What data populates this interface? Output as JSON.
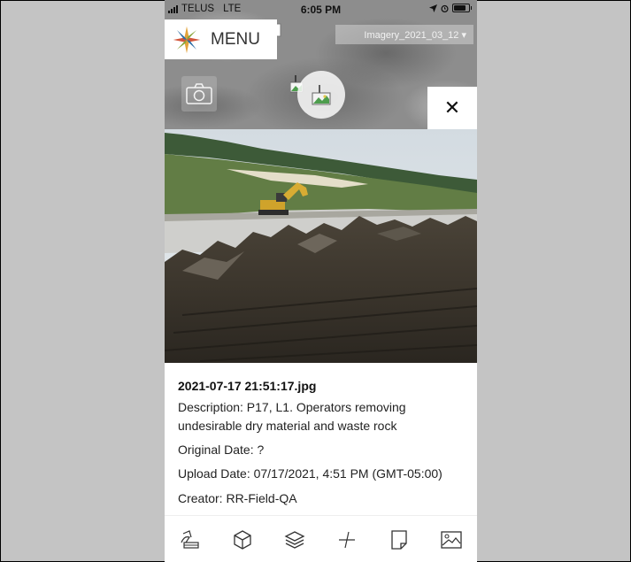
{
  "status_bar": {
    "carrier": "TELUS",
    "network": "LTE",
    "time": "6:05 PM"
  },
  "map": {
    "menu_label": "MENU",
    "imagery_selection": "Imagery_2021_03_12 ▾",
    "close_symbol": "✕",
    "icons": [
      "app-logo-icon",
      "camera-icon",
      "photo-marker-icon",
      "close-icon"
    ]
  },
  "photo": {
    "description": "Excavator working beside a gravel road with dirt and rock piles in the foreground and trees behind"
  },
  "details": {
    "file_name": "2021-07-17 21:51:17.jpg",
    "description": "Description: P17, L1. Operators removing undesirable dry material and waste rock",
    "original_date": "Original Date: ?",
    "upload_date": "Upload Date: 07/17/2021, 4:51 PM (GMT-05:00)",
    "creator": "Creator: RR-Field-QA"
  },
  "toolbar": {
    "icons": [
      "draw-shape-icon",
      "cube-icon",
      "layers-icon",
      "measure-icon",
      "note-icon",
      "image-icon"
    ]
  },
  "colors": {
    "background": "#c4c4c4",
    "panel": "#ffffff",
    "text": "#222222",
    "map_gray": "#8d8d8d"
  }
}
